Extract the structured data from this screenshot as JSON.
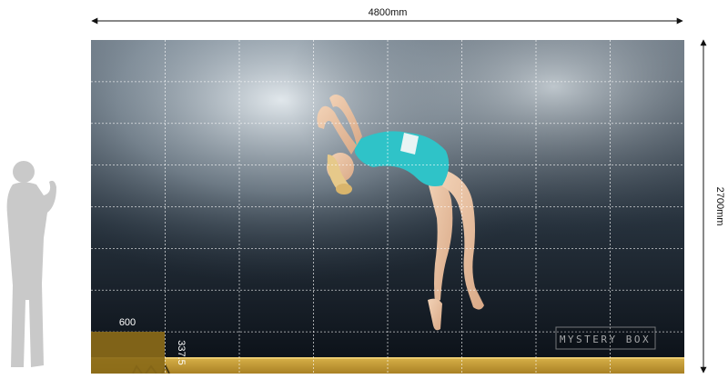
{
  "dimensions": {
    "width_label": "4800mm",
    "height_label": "2700mm"
  },
  "module": {
    "width_label": "600",
    "height_label": "337.5"
  },
  "grid": {
    "columns": 8,
    "rows": 8
  },
  "watermark": {
    "text": "MYSTERY BOX"
  },
  "colors": {
    "module_fill": "#8a6a18",
    "screen_top": "#6e7a86",
    "screen_bottom": "#0a0f16",
    "human_silhouette": "#c9c9c9",
    "leotard": "#2fc3c8"
  }
}
